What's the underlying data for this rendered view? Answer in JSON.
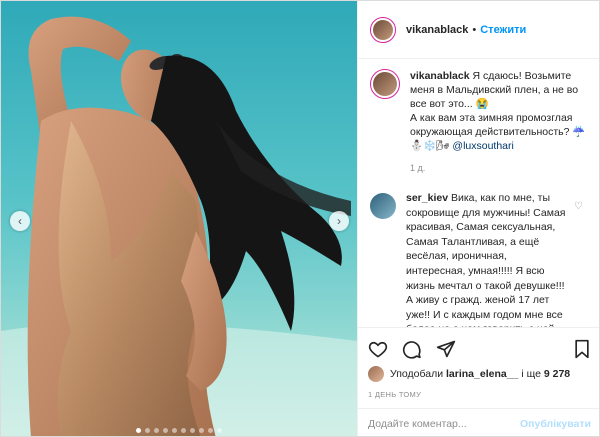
{
  "post_header": {
    "username": "vikanablack",
    "separator": "•",
    "follow_label": "Стежити"
  },
  "caption": {
    "username": "vikanablack",
    "text": "Я сдаюсь! Возьмите меня в Мальдивский плен, а не во все вот это... 😭",
    "text2": "А как вам эта зимняя промозглая окружающая действительность? ☔",
    "emojis": "⛄❄️🌬",
    "mention": "@luxsouthari",
    "time": "1 д."
  },
  "comment": {
    "username": "ser_kiev",
    "text": "Вика, как по мне, ты сокровище для мужчины! Самая красивая, Самая сексуальная, Самая Талантливая, а ещё весёлая, ироничная, интересная, умная!!!!! Я всю жизнь мечтал о такой девушке!!! А живу с гражд. женой 17 лет уже!! И с каждым годом мне все более не о чем говорить с ней, чувствовал! Ты"
  },
  "likes": {
    "prefix": "Уподобали",
    "user": "larina_elena__",
    "middle": "і ще",
    "count": "9 278"
  },
  "posted_ago": "1 ДЕНЬ ТОМУ",
  "add_comment": {
    "placeholder": "Додайте коментар...",
    "publish_label": "Опублікувати"
  },
  "carousel": {
    "prev": "‹",
    "next": "›",
    "dot_count": 10,
    "active_dot": 0
  }
}
